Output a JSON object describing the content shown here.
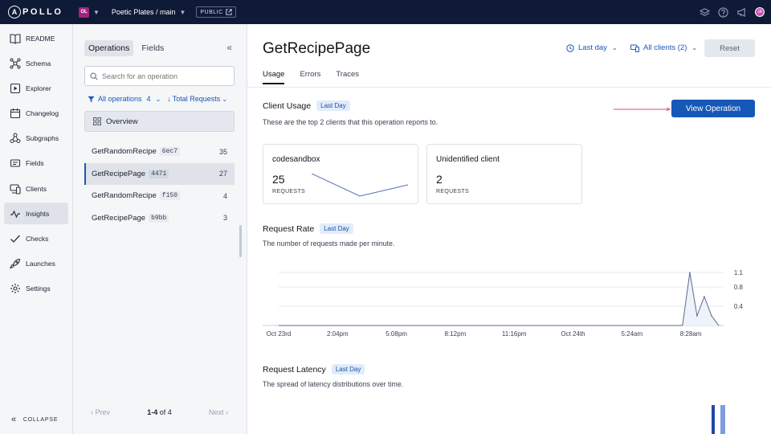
{
  "topbar": {
    "logo_text": "POLLO",
    "logo_mark": "A",
    "org_initials": "OL",
    "graph": "Poetic Plates / main",
    "visibility": "PUBLIC",
    "user_initials": "JA"
  },
  "nav": {
    "items": [
      {
        "label": "README",
        "icon": "readme-icon"
      },
      {
        "label": "Schema",
        "icon": "schema-icon"
      },
      {
        "label": "Explorer",
        "icon": "explorer-icon"
      },
      {
        "label": "Changelog",
        "icon": "changelog-icon"
      },
      {
        "label": "Subgraphs",
        "icon": "subgraphs-icon"
      },
      {
        "label": "Fields",
        "icon": "fields-icon"
      },
      {
        "label": "Clients",
        "icon": "clients-icon"
      },
      {
        "label": "Insights",
        "icon": "insights-icon",
        "active": true
      },
      {
        "label": "Checks",
        "icon": "checks-icon"
      },
      {
        "label": "Launches",
        "icon": "launches-icon"
      },
      {
        "label": "Settings",
        "icon": "settings-icon"
      }
    ],
    "collapse_label": "COLLAPSE"
  },
  "ops_panel": {
    "tab_operations": "Operations",
    "tab_fields": "Fields",
    "search_placeholder": "Search for an operation",
    "filter_all": "All operations",
    "filter_count": "4",
    "filter_sort": "Total Requests",
    "overview": "Overview",
    "rows": [
      {
        "name": "GetRandomRecipe",
        "hash": "6ec7",
        "count": "35"
      },
      {
        "name": "GetRecipePage",
        "hash": "4471",
        "count": "27",
        "active": true
      },
      {
        "name": "GetRandomRecipe",
        "hash": "f150",
        "count": "4"
      },
      {
        "name": "GetRecipePage",
        "hash": "b9bb",
        "count": "3"
      }
    ],
    "pager": {
      "prev": "Prev",
      "range": "1-4",
      "of": "of 4",
      "next": "Next"
    }
  },
  "main": {
    "title": "GetRecipePage",
    "time_filter": "Last day",
    "clients_filter": "All clients (2)",
    "reset": "Reset",
    "tabs": [
      "Usage",
      "Errors",
      "Traces"
    ],
    "client_usage": {
      "title": "Client Usage",
      "pill": "Last Day",
      "desc": "These are the top 2 clients that this operation reports to.",
      "button": "View Operation",
      "cards": [
        {
          "name": "codesandbox",
          "value": "25",
          "label": "REQUESTS"
        },
        {
          "name": "Unidentified client",
          "value": "2",
          "label": "REQUESTS"
        }
      ]
    },
    "request_rate": {
      "title": "Request Rate",
      "pill": "Last Day",
      "desc": "The number of requests made per minute."
    },
    "request_latency": {
      "title": "Request Latency",
      "pill": "Last Day",
      "desc": "The spread of latency distributions over time."
    }
  },
  "colors": {
    "topbar": "#0f1a36",
    "accent": "#1558b8",
    "link": "#1c56b8",
    "pill_bg": "#e1ecfb"
  },
  "chart_data": {
    "type": "line",
    "title": "Request Rate",
    "x_ticks": [
      "Oct 23rd",
      "2:04pm",
      "5:08pm",
      "8:12pm",
      "11:16pm",
      "Oct 24th",
      "5:24am",
      "8:28am"
    ],
    "y_ticks": [
      0.4,
      0.8,
      1.1
    ],
    "ylim": [
      0,
      1.2
    ],
    "series": [
      {
        "x": [
          0,
          0.75,
          0.79,
          0.805,
          0.82,
          0.835,
          0.85,
          0.865,
          0.88,
          0.895,
          0.91
        ],
        "values": [
          0,
          0,
          0,
          0,
          0,
          0,
          1.1,
          0.2,
          0.6,
          0.2,
          0
        ]
      }
    ]
  }
}
